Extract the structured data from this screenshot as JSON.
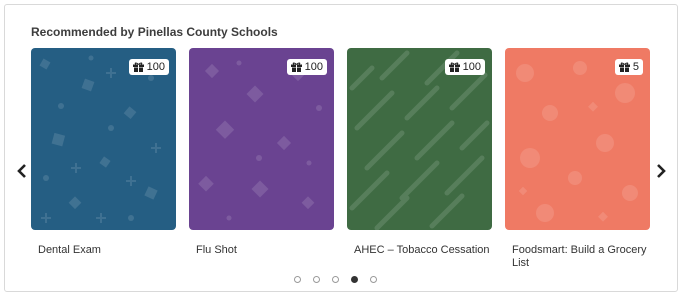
{
  "section": {
    "title": "Recommended by Pinellas County Schools"
  },
  "cards": [
    {
      "label": "Dental Exam",
      "points": "100",
      "color": "#255e83",
      "icon": "gift-icon"
    },
    {
      "label": "Flu Shot",
      "points": "100",
      "color": "#6a4391",
      "icon": "gift-icon"
    },
    {
      "label": "AHEC – Tobacco Cessation",
      "points": "100",
      "color": "#3f6b43",
      "icon": "gift-icon"
    },
    {
      "label": "Foodsmart: Build a Grocery List",
      "points": "5",
      "color": "#ef7a64",
      "icon": "gift-icon"
    }
  ],
  "carousel": {
    "prev_icon": "chevron-left-icon",
    "next_icon": "chevron-right-icon",
    "page_count": 5,
    "active_page": 4
  }
}
